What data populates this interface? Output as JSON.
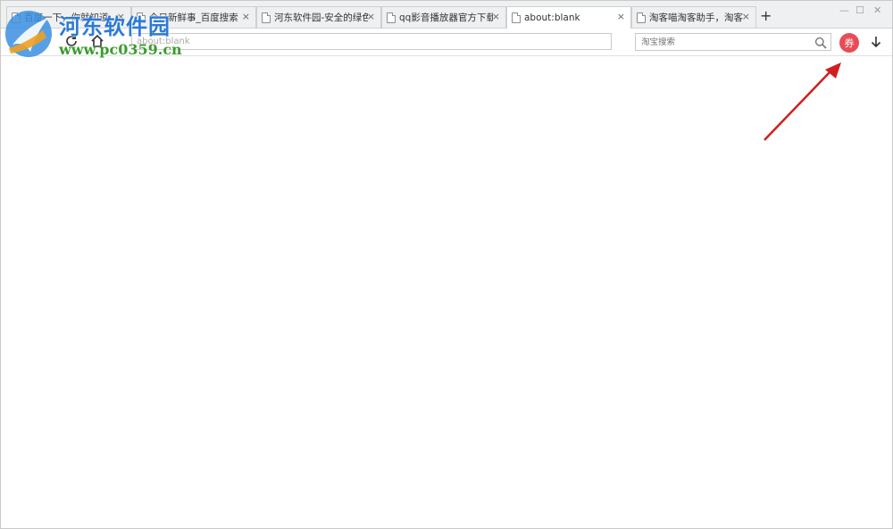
{
  "tabs": [
    {
      "label": "百度一下，你就知道",
      "close": "×",
      "active": false
    },
    {
      "label": "今日新鲜事_百度搜索",
      "close": "×",
      "active": false
    },
    {
      "label": "河东软件园-安全的绿色软件下载站",
      "close": "×",
      "active": false
    },
    {
      "label": "qq影音播放器官方下载|qq影音",
      "close": "×",
      "active": false
    },
    {
      "label": "about:blank",
      "close": "×",
      "active": true
    },
    {
      "label": "淘客喵淘客助手，淘客内部优惠券",
      "close": "×",
      "active": false
    }
  ],
  "new_tab": "+",
  "window_controls": {
    "minimize": "—",
    "maximize": "☐",
    "close": "✕"
  },
  "toolbar": {
    "address_value": "about:blank",
    "search_placeholder": "淘宝搜索",
    "coupon_label": "券"
  },
  "watermark": {
    "title": "河东软件园",
    "url": "www.pc0359.cn"
  },
  "colors": {
    "coupon": "#e84c57",
    "arrow": "#d11f1f",
    "watermark_blue": "#2c7ad6",
    "watermark_green": "#3a9c2f"
  }
}
